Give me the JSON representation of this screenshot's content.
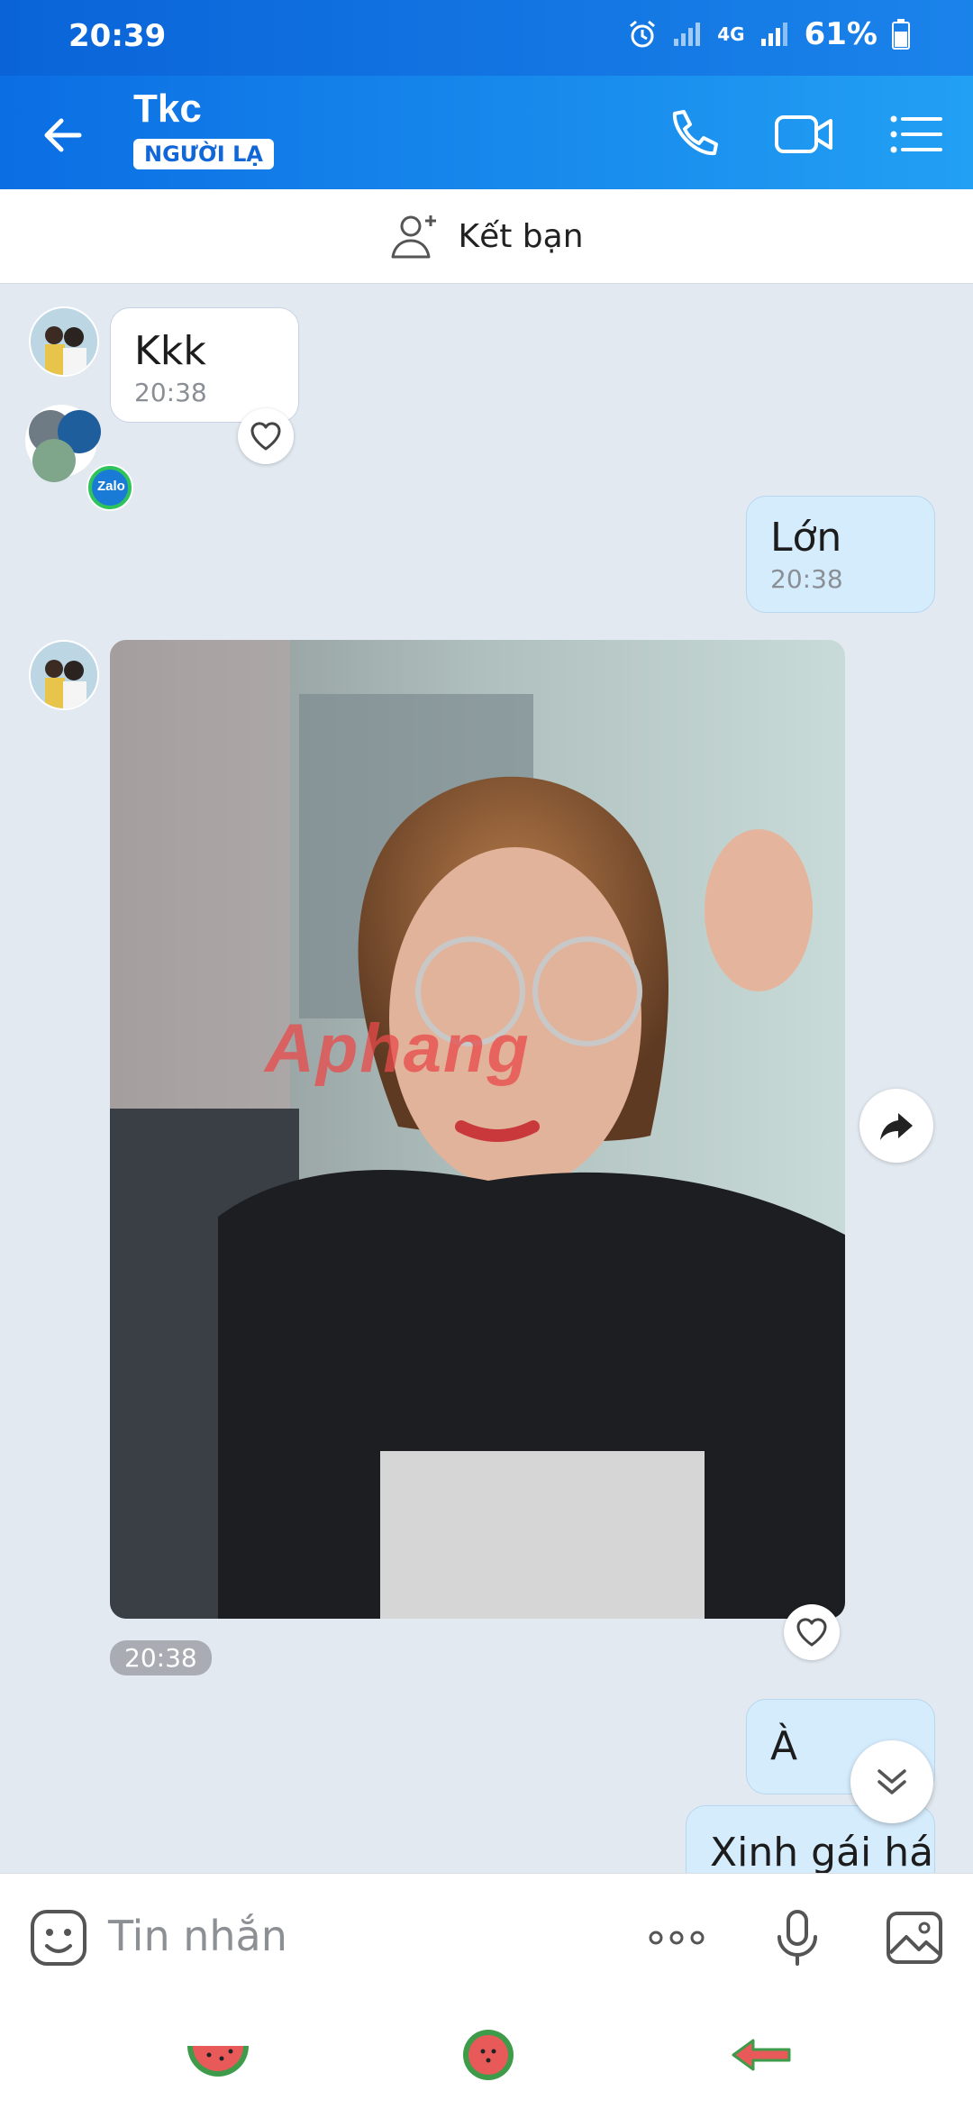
{
  "status_bar": {
    "time": "20:39",
    "network": "4G",
    "battery": "61%"
  },
  "header": {
    "contact_name": "Tkc",
    "badge": "NGƯỜI LẠ"
  },
  "add_friend": {
    "label": "Kết bạn"
  },
  "messages": [
    {
      "direction": "in",
      "text": "Kkk",
      "time": "20:38"
    },
    {
      "direction": "out",
      "text": "Lớn",
      "time": "20:38"
    },
    {
      "direction": "in",
      "type": "photo",
      "watermark": "Aphang",
      "time": "20:38"
    },
    {
      "direction": "out",
      "text": "À"
    },
    {
      "direction": "out",
      "text": "Xinh gái há"
    }
  ],
  "composer": {
    "placeholder": "Tin nhắn"
  },
  "colors": {
    "header_start": "#0b6ee3",
    "header_end": "#22a0f4",
    "chat_bg": "#e2e9f1",
    "out_bubble": "#d5ecfd"
  }
}
